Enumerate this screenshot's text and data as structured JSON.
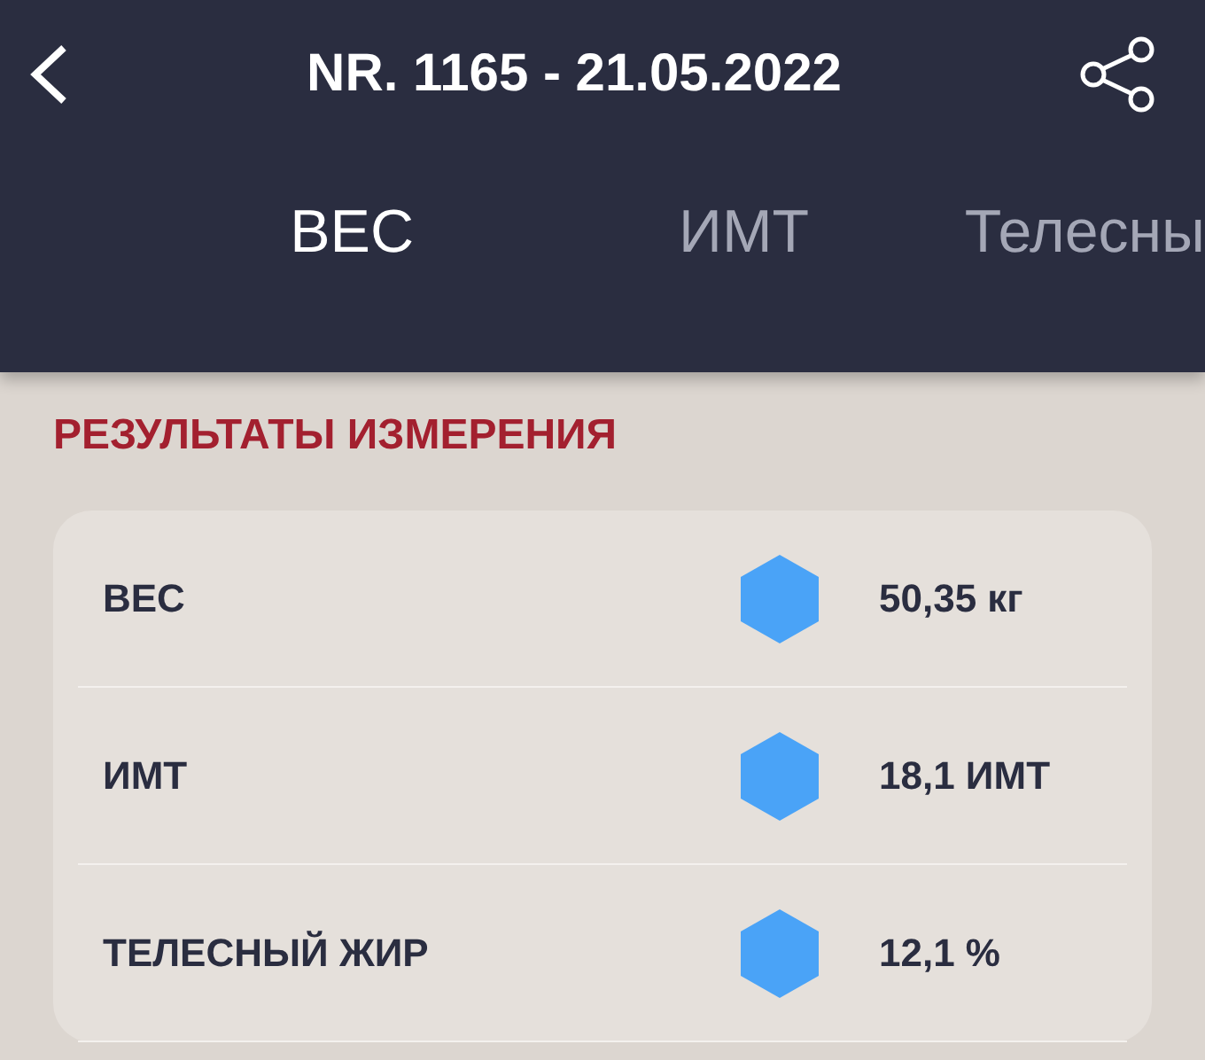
{
  "header": {
    "title": "NR. 1165 - 21.05.2022"
  },
  "tabs": [
    {
      "label": "ВЕС",
      "selected": true
    },
    {
      "label": "ИМТ",
      "selected": false
    },
    {
      "label": "Телесны",
      "selected": false
    }
  ],
  "section_title": "РЕЗУЛЬТАТЫ ИЗМЕРЕНИЯ",
  "rows": [
    {
      "label": "ВЕС",
      "value": "50,35 кг",
      "color": "#4aa3f7"
    },
    {
      "label": "ИМТ",
      "value": "18,1 ИМТ",
      "color": "#4aa3f7"
    },
    {
      "label": "ТЕЛЕСНЫЙ ЖИР",
      "value": "12,1 %",
      "color": "#4aa3f7"
    }
  ]
}
